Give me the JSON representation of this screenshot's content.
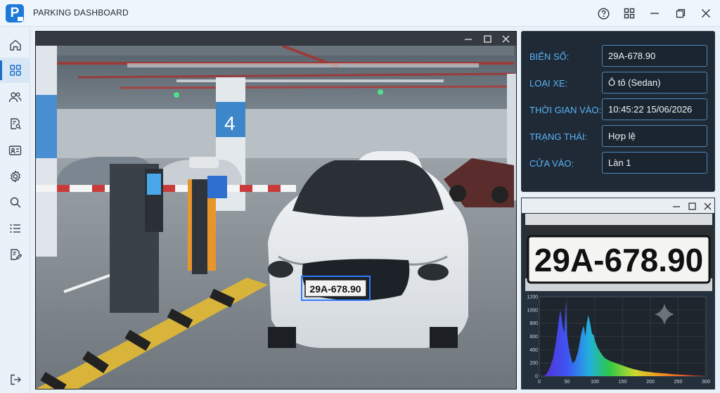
{
  "app": {
    "logo_letter": "P",
    "title": "PARKING DASHBOARD"
  },
  "titlebar_icons": [
    "help-icon",
    "grid-icon",
    "minimize-icon",
    "restore-icon",
    "close-icon"
  ],
  "sidebar": {
    "items": [
      {
        "name": "home-icon",
        "active": false
      },
      {
        "name": "dashboard-icon",
        "active": true
      },
      {
        "name": "users-icon",
        "active": false
      },
      {
        "name": "document-search-icon",
        "active": false
      },
      {
        "name": "id-card-icon",
        "active": false
      },
      {
        "name": "settings-icon",
        "active": false
      },
      {
        "name": "search-icon",
        "active": false
      },
      {
        "name": "list-icon",
        "active": false
      },
      {
        "name": "edit-document-icon",
        "active": false
      },
      {
        "name": "logout-icon",
        "active": false
      }
    ]
  },
  "camera": {
    "plate_overlay": "29A-678.90",
    "pillar_number": "4"
  },
  "info": {
    "rows": [
      {
        "label": "BIỂN SỐ:",
        "value": "29A-678.90"
      },
      {
        "label": "LOẠI XE:",
        "value": "Ô tô (Sedan)"
      },
      {
        "label": "THỜI GIAN VÀO:",
        "value": "10:45:22 15/06/2026"
      },
      {
        "label": "TRẠNG THÁI:",
        "value": "Hợp lệ"
      },
      {
        "label": "CỬA VÀO:",
        "value": "Làn 1"
      }
    ]
  },
  "plate_crop": {
    "text": "29A-678.90"
  },
  "chart_data": {
    "type": "area",
    "title": "",
    "xlabel": "",
    "ylabel": "",
    "xlim": [
      0,
      300
    ],
    "ylim": [
      0,
      1200
    ],
    "xticks": [
      "0",
      "50",
      "100",
      "150",
      "200",
      "250",
      "300"
    ],
    "yticks": [
      "0",
      "200",
      "400",
      "600",
      "800",
      "1000",
      "1200"
    ],
    "colors": "spectrum",
    "grid": true,
    "x": [
      0,
      5,
      10,
      15,
      20,
      25,
      30,
      33,
      35,
      38,
      40,
      42,
      45,
      48,
      50,
      53,
      55,
      58,
      60,
      65,
      70,
      75,
      78,
      80,
      83,
      85,
      88,
      90,
      93,
      95,
      98,
      100,
      105,
      110,
      115,
      120,
      130,
      140,
      150,
      160,
      170,
      180,
      190,
      200,
      210,
      220,
      230,
      240,
      250,
      260,
      270,
      280,
      290,
      300
    ],
    "values": [
      0,
      0,
      10,
      60,
      150,
      280,
      520,
      700,
      850,
      1000,
      880,
      760,
      650,
      1150,
      620,
      430,
      350,
      250,
      190,
      240,
      380,
      620,
      720,
      760,
      600,
      770,
      920,
      860,
      730,
      640,
      620,
      540,
      430,
      360,
      300,
      260,
      220,
      190,
      160,
      130,
      105,
      85,
      70,
      60,
      50,
      45,
      40,
      30,
      25,
      20,
      15,
      10,
      5,
      0
    ]
  }
}
